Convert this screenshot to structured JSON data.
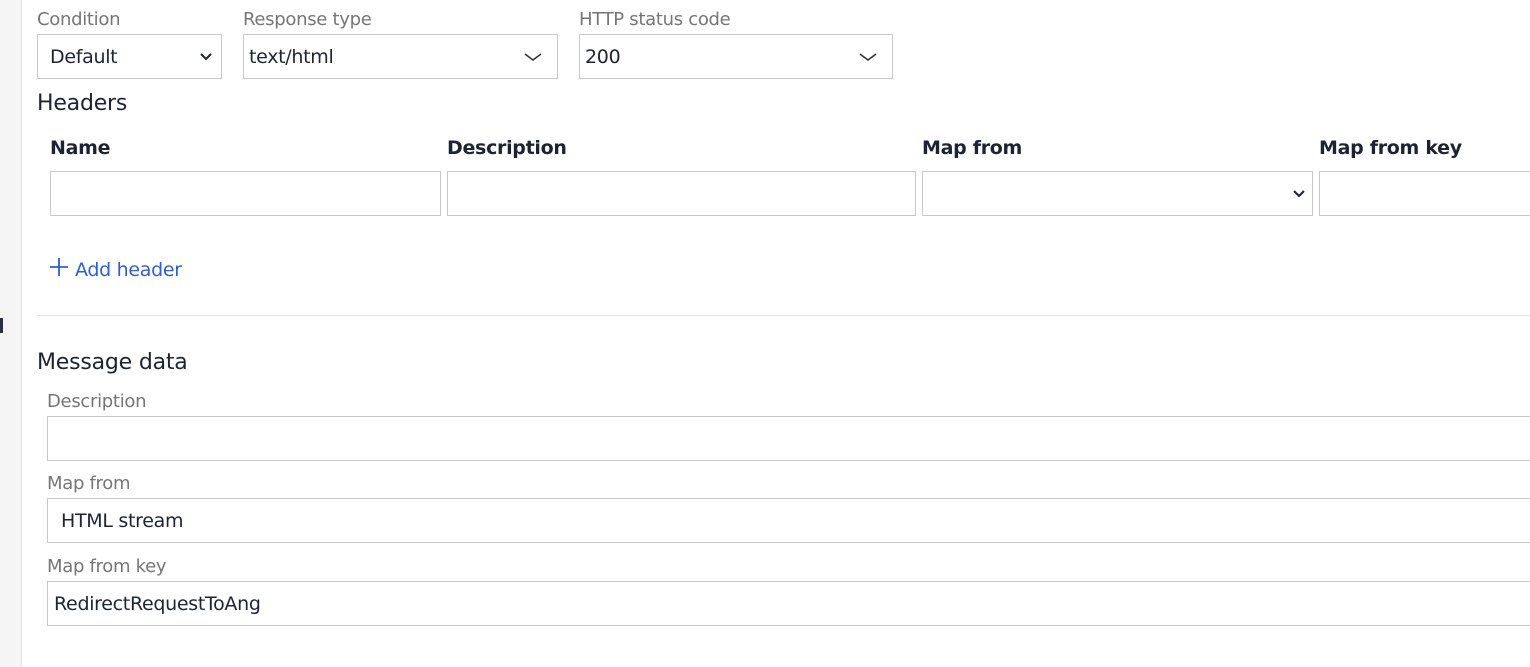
{
  "top_fields": {
    "condition": {
      "label": "Condition",
      "value": "Default",
      "icon": "chevron-down-icon"
    },
    "response_type": {
      "label": "Response type",
      "value": "text/html",
      "icon": "chevron-down-icon"
    },
    "http_status_code": {
      "label": "HTTP status code",
      "value": "200",
      "icon": "chevron-down-icon"
    }
  },
  "headers": {
    "title": "Headers",
    "columns": {
      "name": "Name",
      "description": "Description",
      "map_from": "Map from",
      "map_from_key": "Map from key"
    },
    "row": {
      "name": "",
      "description": "",
      "map_from": "",
      "map_from_key": ""
    },
    "add_label": "Add header",
    "add_icon": "plus-icon"
  },
  "message_data": {
    "title": "Message data",
    "description": {
      "label": "Description",
      "value": ""
    },
    "map_from": {
      "label": "Map from",
      "value": "HTML stream"
    },
    "map_from_key": {
      "label": "Map from key",
      "value": "RedirectRequestToAng"
    }
  },
  "colors": {
    "link": "#2e5ed6",
    "text": "#1d2334",
    "label": "#767676",
    "border": "#c8c8c8"
  }
}
